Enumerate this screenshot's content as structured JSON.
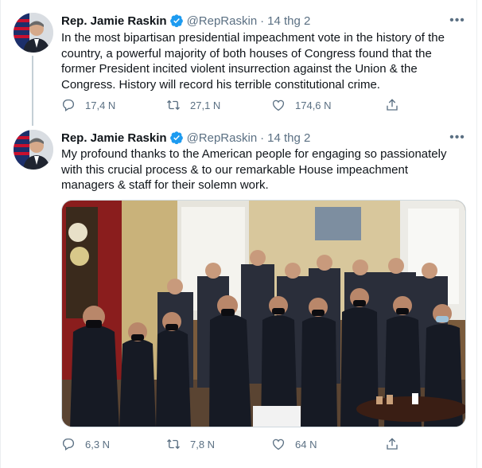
{
  "tweets": [
    {
      "name": "Rep. Jamie Raskin",
      "handle": "@RepRaskin",
      "separator": "·",
      "time": "14 thg 2",
      "text": "In the most bipartisan presidential impeachment vote in the history of the country, a powerful majority of both houses of Congress found that the former President incited violent insurrection against the Union & the Congress. History will record his terrible constitutional crime.",
      "replies": "17,4 N",
      "retweets": "27,1 N",
      "likes": "174,6 N"
    },
    {
      "name": "Rep. Jamie Raskin",
      "handle": "@RepRaskin",
      "separator": "·",
      "time": "14 thg 2",
      "text": "My profound thanks to the American people for engaging so passionately with this crucial process & to our remarkable House impeachment managers & staff for their solemn work.",
      "replies": "6,3 N",
      "retweets": "7,8 N",
      "likes": "64 N"
    }
  ],
  "icons": {
    "reply": "reply-icon",
    "retweet": "retweet-icon",
    "like": "heart-icon",
    "share": "share-icon",
    "more": "more-options-icon",
    "verified": "verified-badge-icon"
  },
  "colors": {
    "text": "#0f1419",
    "secondary": "#5b7083",
    "verified": "#1d9bf0",
    "thread_line": "#c4cfd6"
  }
}
